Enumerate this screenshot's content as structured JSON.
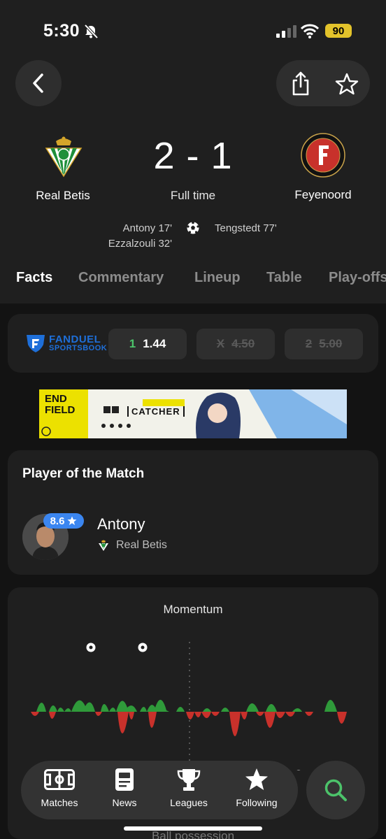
{
  "status_bar": {
    "time": "5:30",
    "battery": "90"
  },
  "header": {
    "back_icon": "chevron-left-icon",
    "share_icon": "share-icon",
    "favorite_icon": "star-outline-icon"
  },
  "match": {
    "home_team": "Real Betis",
    "away_team": "Feyenoord",
    "score": "2 - 1",
    "status": "Full time",
    "home_scorers": [
      "Antony 17'",
      "Ezzalzouli 32'"
    ],
    "away_scorers": [
      "Tengstedt 77'"
    ]
  },
  "tabs": [
    "Facts",
    "Commentary",
    "Lineup",
    "Table",
    "Play-offs"
  ],
  "odds": {
    "provider_name": "FANDUEL",
    "provider_sub": "SPORTSBOOK",
    "options": [
      {
        "key": "1",
        "value": "1.44",
        "available": true
      },
      {
        "key": "X",
        "value": "4.50",
        "available": false
      },
      {
        "key": "2",
        "value": "5.00",
        "available": false
      }
    ]
  },
  "banner": {
    "brand_line1": "END",
    "brand_line2": "FIELD",
    "tag": "CATCHER"
  },
  "player_of_match": {
    "title": "Player of the Match",
    "rating": "8.6",
    "name": "Antony",
    "team": "Real Betis"
  },
  "momentum": {
    "title": "Momentum"
  },
  "bottom_nav": {
    "items": [
      {
        "label": "Matches",
        "icon": "pitch-icon"
      },
      {
        "label": "News",
        "icon": "news-icon"
      },
      {
        "label": "Leagues",
        "icon": "trophy-icon"
      },
      {
        "label": "Following",
        "icon": "star-icon"
      }
    ],
    "search_icon": "search-icon"
  },
  "next_section": {
    "title": "Ball possession"
  },
  "colors": {
    "home": "#2f9a3a",
    "away": "#c8312b",
    "accent": "#4cc36a",
    "rating": "#3b86f0"
  }
}
